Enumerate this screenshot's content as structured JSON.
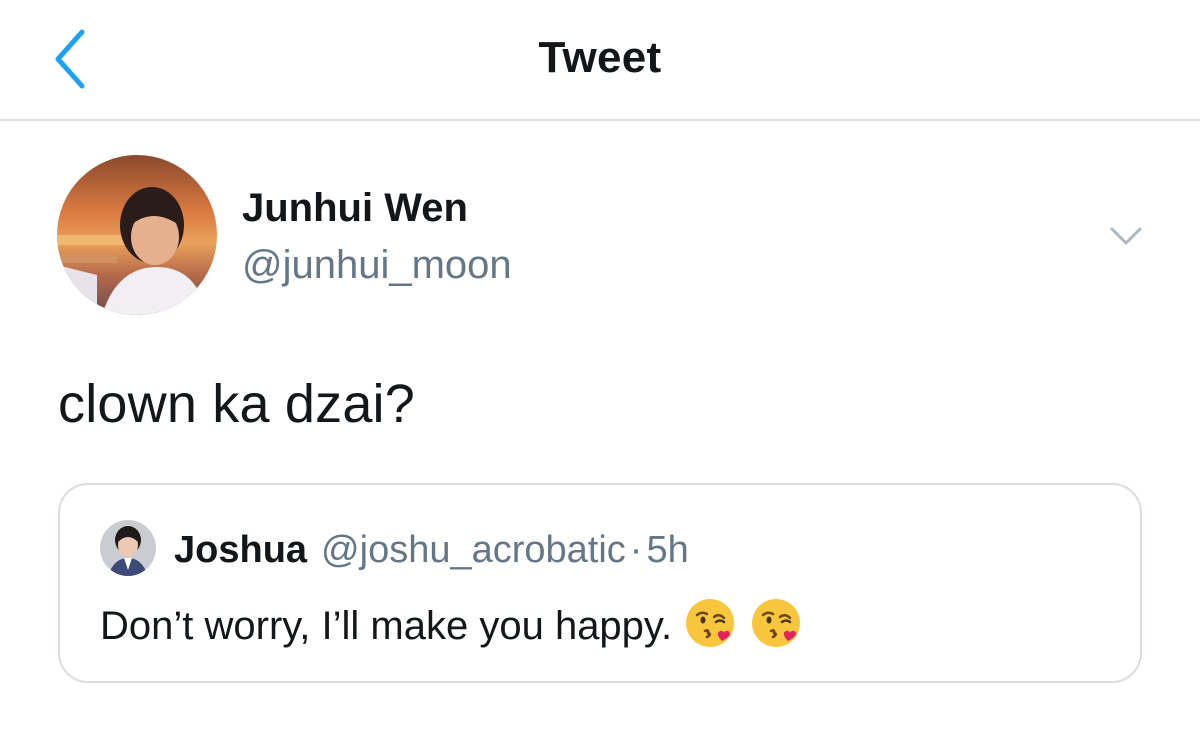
{
  "header": {
    "title": "Tweet",
    "back_icon": "chevron-left-icon",
    "accent_color": "#1da1f2"
  },
  "tweet": {
    "author_name": "Junhui Wen",
    "author_handle": "@junhui_moon",
    "more_icon": "chevron-down-icon",
    "text": "clown ka dzai?"
  },
  "quote": {
    "author_name": "Joshua",
    "author_handle": "@joshu_acrobatic",
    "separator": "·",
    "time": "5h",
    "text": "Don’t worry, I’ll make you happy.",
    "emojis": [
      "face-blowing-kiss-emoji",
      "face-blowing-kiss-emoji"
    ]
  },
  "colors": {
    "text_primary": "#14171a",
    "text_secondary": "#657786",
    "border": "#d9dde1"
  }
}
